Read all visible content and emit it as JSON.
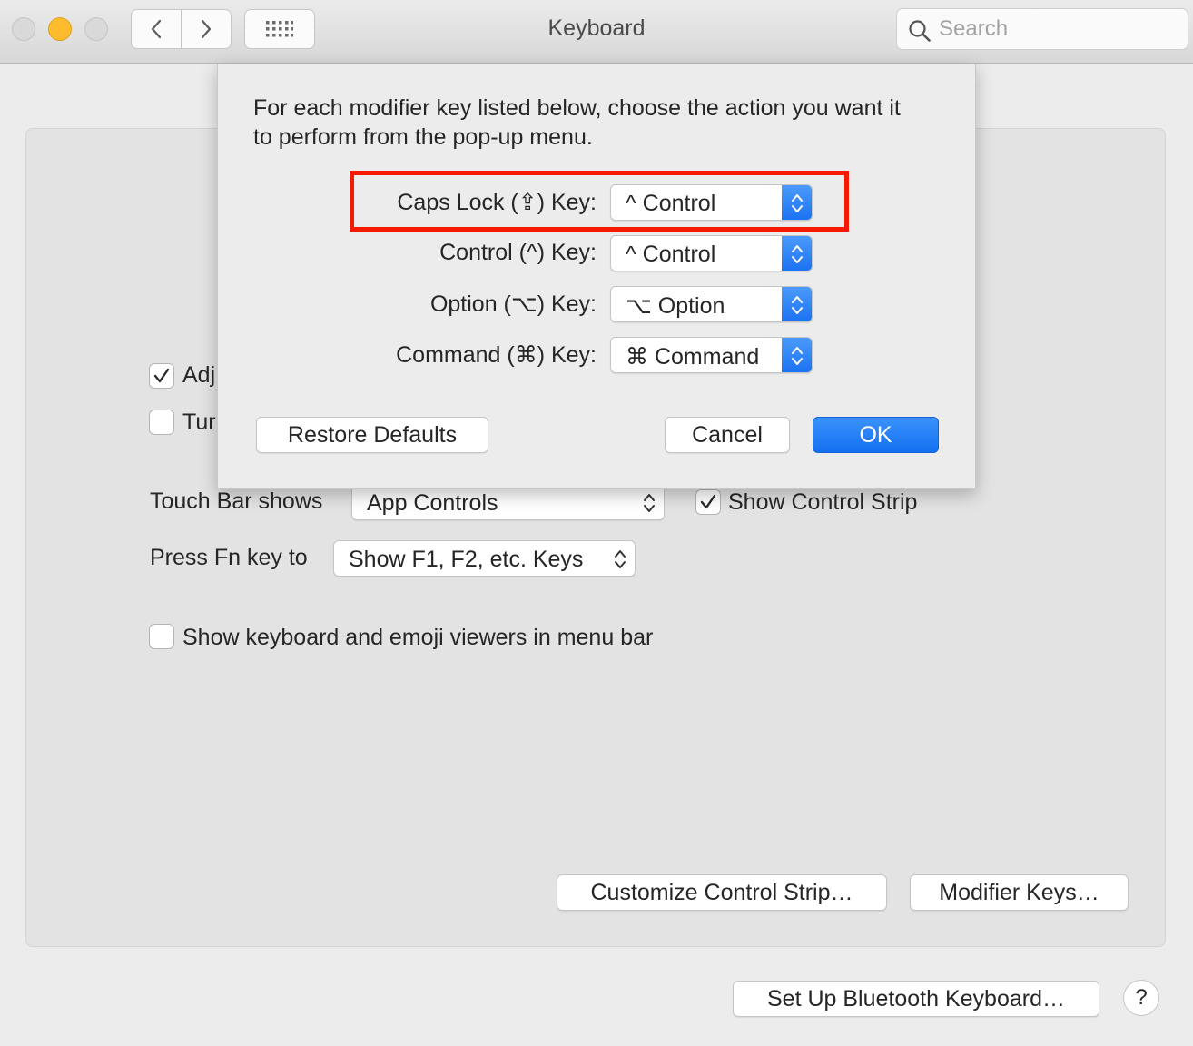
{
  "window": {
    "title": "Keyboard",
    "search_placeholder": "Search"
  },
  "toolbar": {
    "back_icon": "chevron-left-icon",
    "forward_icon": "chevron-right-icon",
    "show_all_icon": "grid-icon"
  },
  "panel": {
    "checkbox_adjust": {
      "label": "Adj",
      "checked": true
    },
    "checkbox_turn": {
      "label": "Tur",
      "checked": false
    },
    "touch_bar_label": "Touch Bar shows",
    "touch_bar_value": "App Controls",
    "show_control_strip": {
      "label": "Show Control Strip",
      "checked": true
    },
    "fn_key_label": "Press Fn key to",
    "fn_key_value": "Show F1, F2, etc. Keys",
    "show_viewers": {
      "label": "Show keyboard and emoji viewers in menu bar",
      "checked": false
    },
    "customize_button": "Customize Control Strip…",
    "modifier_button": "Modifier Keys…"
  },
  "footer": {
    "bluetooth_button": "Set Up Bluetooth Keyboard…",
    "help_button": "?"
  },
  "sheet": {
    "intro": "For each modifier key listed below, choose the action you want it to perform from the pop-up menu.",
    "rows": [
      {
        "label": "Caps Lock (⇪) Key:",
        "value": "^ Control"
      },
      {
        "label": "Control (^) Key:",
        "value": "^ Control"
      },
      {
        "label": "Option (⌥) Key:",
        "value": "⌥ Option"
      },
      {
        "label": "Command (⌘) Key:",
        "value": "⌘ Command"
      }
    ],
    "restore_button": "Restore Defaults",
    "cancel_button": "Cancel",
    "ok_button": "OK"
  },
  "colors": {
    "accent": "#1870f1",
    "highlight_box": "#f51a00",
    "minimize": "#fdbc2e"
  }
}
